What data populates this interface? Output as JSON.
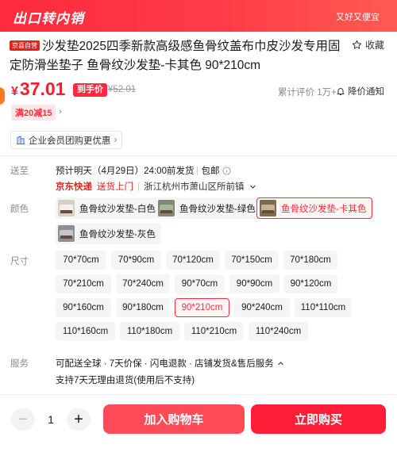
{
  "banner": {
    "title": "出口转内销",
    "slogan": "又好又便宜"
  },
  "product": {
    "badge": "京喜自营",
    "title": "沙发垫2025四季新款高级感鱼骨纹盖布巾皮沙发专用固定防滑坐垫子 鱼骨纹沙发垫-卡其色 90*210cm",
    "favorite_label": "收藏"
  },
  "price": {
    "symbol": "¥",
    "value": "37.01",
    "tag": "到手价",
    "original": "¥52.01",
    "stats": "累计评价 1万+",
    "notify_label": "降价通知",
    "accent_color": "#ff1d2c"
  },
  "promo": {
    "coupon": "满20减15",
    "arrow": "›",
    "corporate": "企业会员团购更优惠",
    "corporate_arrow": "›"
  },
  "delivery": {
    "label": "送至",
    "eta": "预计明天（4月29日）24:00前发货",
    "free_shipping": "包邮",
    "carrier": "京东快递",
    "pickup": "送货上门",
    "address": "浙江杭州市萧山区所前镇"
  },
  "color": {
    "label": "颜色",
    "options": [
      {
        "label": "鱼骨纹沙发垫-白色"
      },
      {
        "label": "鱼骨纹沙发垫-绿色"
      },
      {
        "label": "鱼骨纹沙发垫-卡其色"
      },
      {
        "label": "鱼骨纹沙发垫-灰色"
      }
    ],
    "selected": "鱼骨纹沙发垫-卡其色"
  },
  "size": {
    "label": "尺寸",
    "options": [
      "70*70cm",
      "70*90cm",
      "70*120cm",
      "70*150cm",
      "70*180cm",
      "70*210cm",
      "70*240cm",
      "90*70cm",
      "90*90cm",
      "90*120cm",
      "90*160cm",
      "90*180cm",
      "90*210cm",
      "90*240cm",
      "110*110cm",
      "110*160cm",
      "110*180cm",
      "110*210cm",
      "110*240cm"
    ],
    "selected": "90*210cm"
  },
  "service": {
    "label": "服务",
    "line1": "可配送全球 · 7天价保 · 闪电退款 · 店铺发货&售后服务",
    "line2": "支持7天无理由退货(使用后不支持)"
  },
  "purchase": {
    "minus": "−",
    "quantity": "1",
    "plus": "+",
    "add_to_cart": "加入购物车",
    "buy_now": "立即购买"
  }
}
